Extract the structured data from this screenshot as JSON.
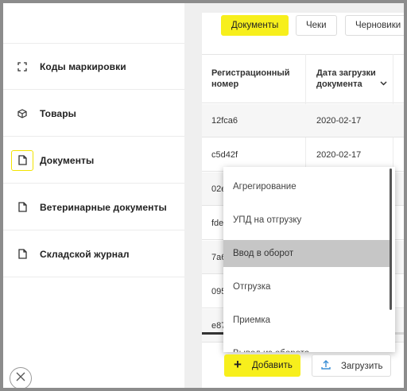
{
  "sidebar": {
    "items": [
      {
        "label": "Коды маркировки",
        "icon": "scan-icon"
      },
      {
        "label": "Товары",
        "icon": "box-icon"
      },
      {
        "label": "Документы",
        "icon": "document-icon",
        "active": true
      },
      {
        "label": "Ветеринарные документы",
        "icon": "document-icon"
      },
      {
        "label": "Складской журнал",
        "icon": "document-icon"
      }
    ]
  },
  "tabs": [
    "Документы",
    "Чеки",
    "Черновики"
  ],
  "table": {
    "headers": {
      "reg_number": "Регистрационный номер",
      "upload_date": "Дата загрузки документа"
    },
    "rows": [
      {
        "id": "12fca6",
        "date": "2020-02-17"
      },
      {
        "id": "c5d42f",
        "date": "2020-02-17"
      },
      {
        "id": "02e",
        "date": ""
      },
      {
        "id": "fde",
        "date": ""
      },
      {
        "id": "7a6",
        "date": ""
      },
      {
        "id": "095",
        "date": ""
      },
      {
        "id": "e87",
        "date": ""
      }
    ]
  },
  "dropdown": {
    "items": [
      "Агрегирование",
      "УПД на отгрузку",
      "Ввод в оборот",
      "Отгрузка",
      "Приемка",
      "Вывод из оборота"
    ],
    "highlighted": "Ввод в оборот"
  },
  "actions": {
    "add_label": "Добавить",
    "upload_label": "Загрузить"
  },
  "colors": {
    "accent": "#f7ef1c",
    "highlight": "#c6c6c6"
  }
}
